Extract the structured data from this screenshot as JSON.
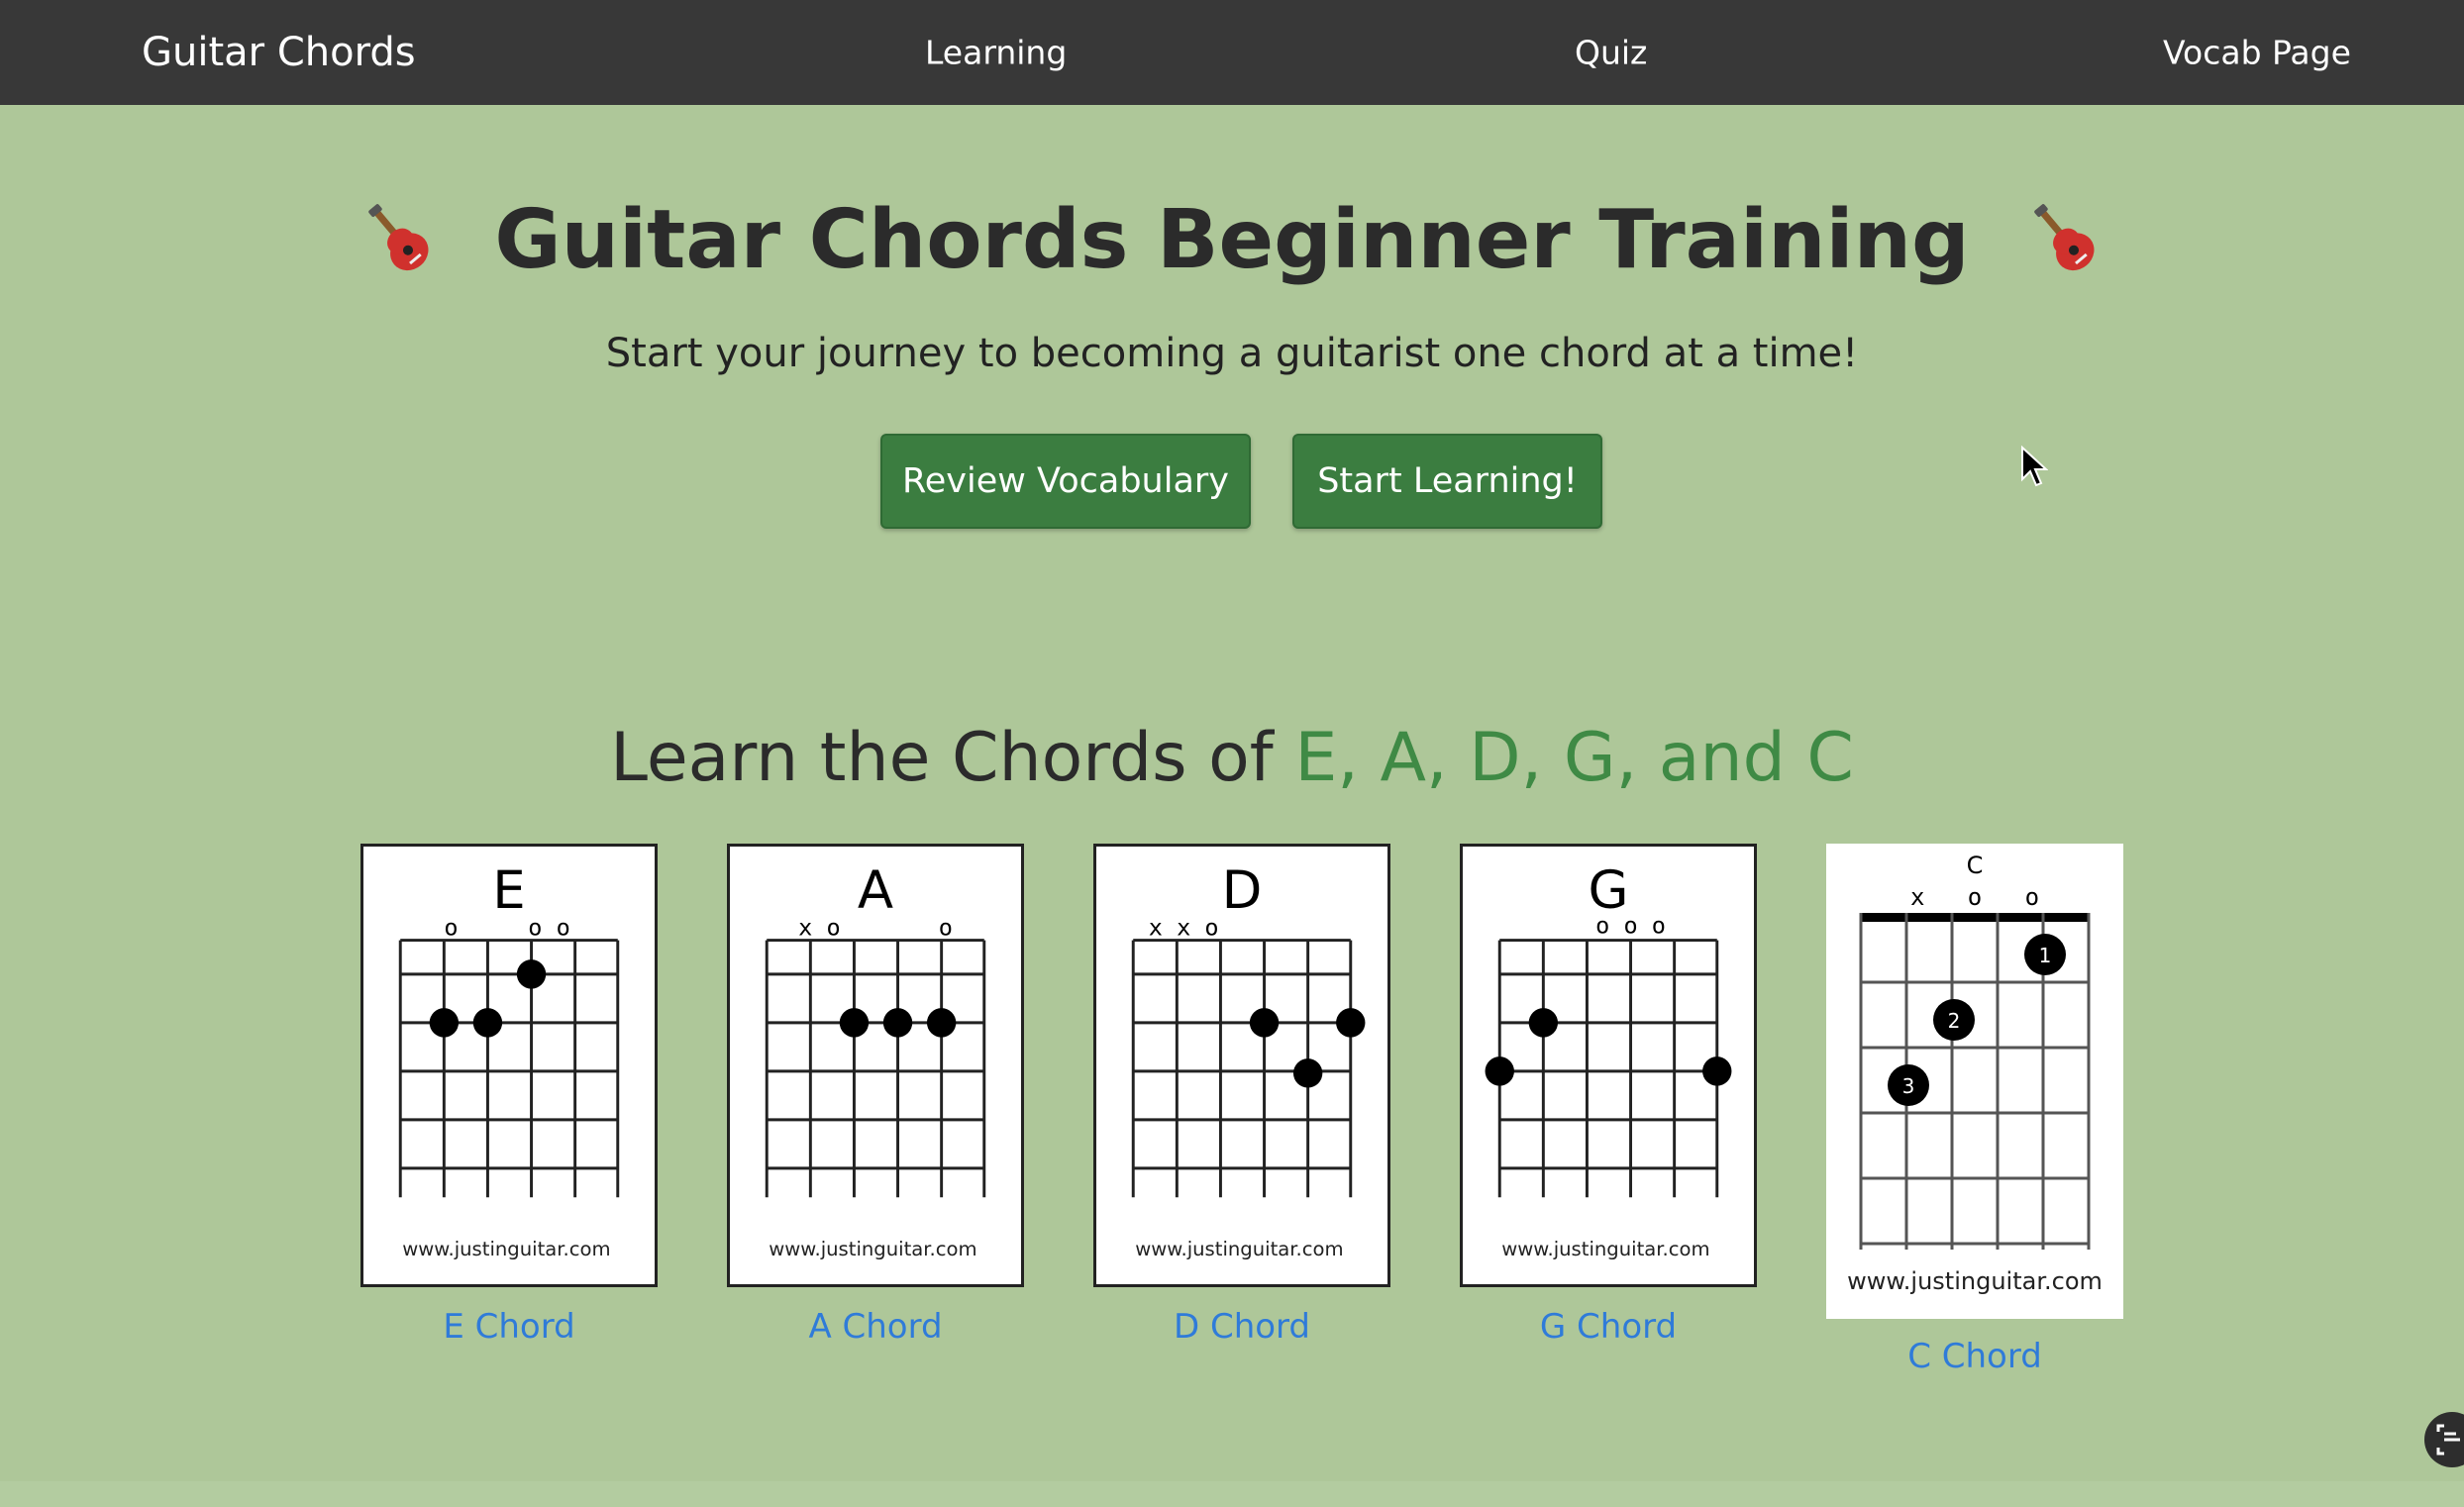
{
  "nav": {
    "brand": "Guitar Chords",
    "links": [
      "Learning",
      "Quiz",
      "Vocab Page"
    ]
  },
  "hero": {
    "title": "Guitar Chords Beginner Training",
    "subtitle": "Start your journey to becoming a guitarist one chord at a time!",
    "buttons": {
      "vocab": "Review Vocabulary",
      "learn": "Start Learning!"
    }
  },
  "section": {
    "title_prefix": "Learn the Chords of ",
    "title_highlight": "E, A, D, G, and C"
  },
  "chords": [
    {
      "name": "E",
      "caption": "E Chord",
      "markers": "o     o o",
      "credit": "www.justinguitar.com"
    },
    {
      "name": "A",
      "caption": "A Chord",
      "markers": "x o       o",
      "credit": "www.justinguitar.com"
    },
    {
      "name": "D",
      "caption": "D Chord",
      "markers": "x x o",
      "credit": "www.justinguitar.com"
    },
    {
      "name": "G",
      "caption": "G Chord",
      "markers": "o o o",
      "credit": "www.justinguitar.com"
    },
    {
      "name": "C",
      "caption": "C Chord",
      "markers": "x   o   o",
      "credit": "www.justinguitar.com"
    }
  ],
  "colors": {
    "background": "#aec799",
    "nav": "#383838",
    "button": "#3b7d40",
    "highlight": "#3f8a45",
    "link": "#2f7bd9"
  }
}
